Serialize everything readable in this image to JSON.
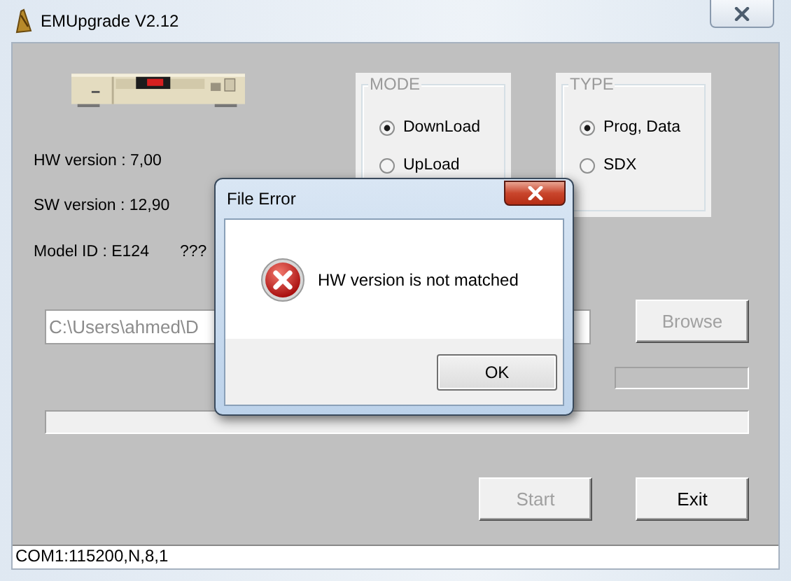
{
  "window": {
    "title": "EMUpgrade V2.12"
  },
  "info": [
    {
      "text": "HW version : 7,00"
    },
    {
      "text": "SW version : 12,90"
    },
    {
      "text": "Model ID : E124",
      "note": "???"
    }
  ],
  "mode": {
    "title": "MODE",
    "options": [
      {
        "label": "DownLoad",
        "selected": true
      },
      {
        "label": "UpLoad",
        "selected": false
      }
    ]
  },
  "type": {
    "title": "TYPE",
    "options": [
      {
        "label": "Prog, Data",
        "selected": true
      },
      {
        "label": "SDX",
        "selected": false
      }
    ]
  },
  "path_field": {
    "value": "C:\\Users\\ahmed\\D",
    "disabled": true
  },
  "browse_button": {
    "label": "Browse",
    "disabled": true
  },
  "file_progress": {
    "level": 0
  },
  "total_progress": {
    "level": 0
  },
  "start_button": {
    "label": "Start",
    "disabled": true
  },
  "exit_button": {
    "label": "Exit",
    "disabled": false
  },
  "status_bar": {
    "text": "COM1:115200,N,8,1"
  },
  "dialog": {
    "title": "File Error",
    "message": "HW version is not matched",
    "button": "OK"
  }
}
